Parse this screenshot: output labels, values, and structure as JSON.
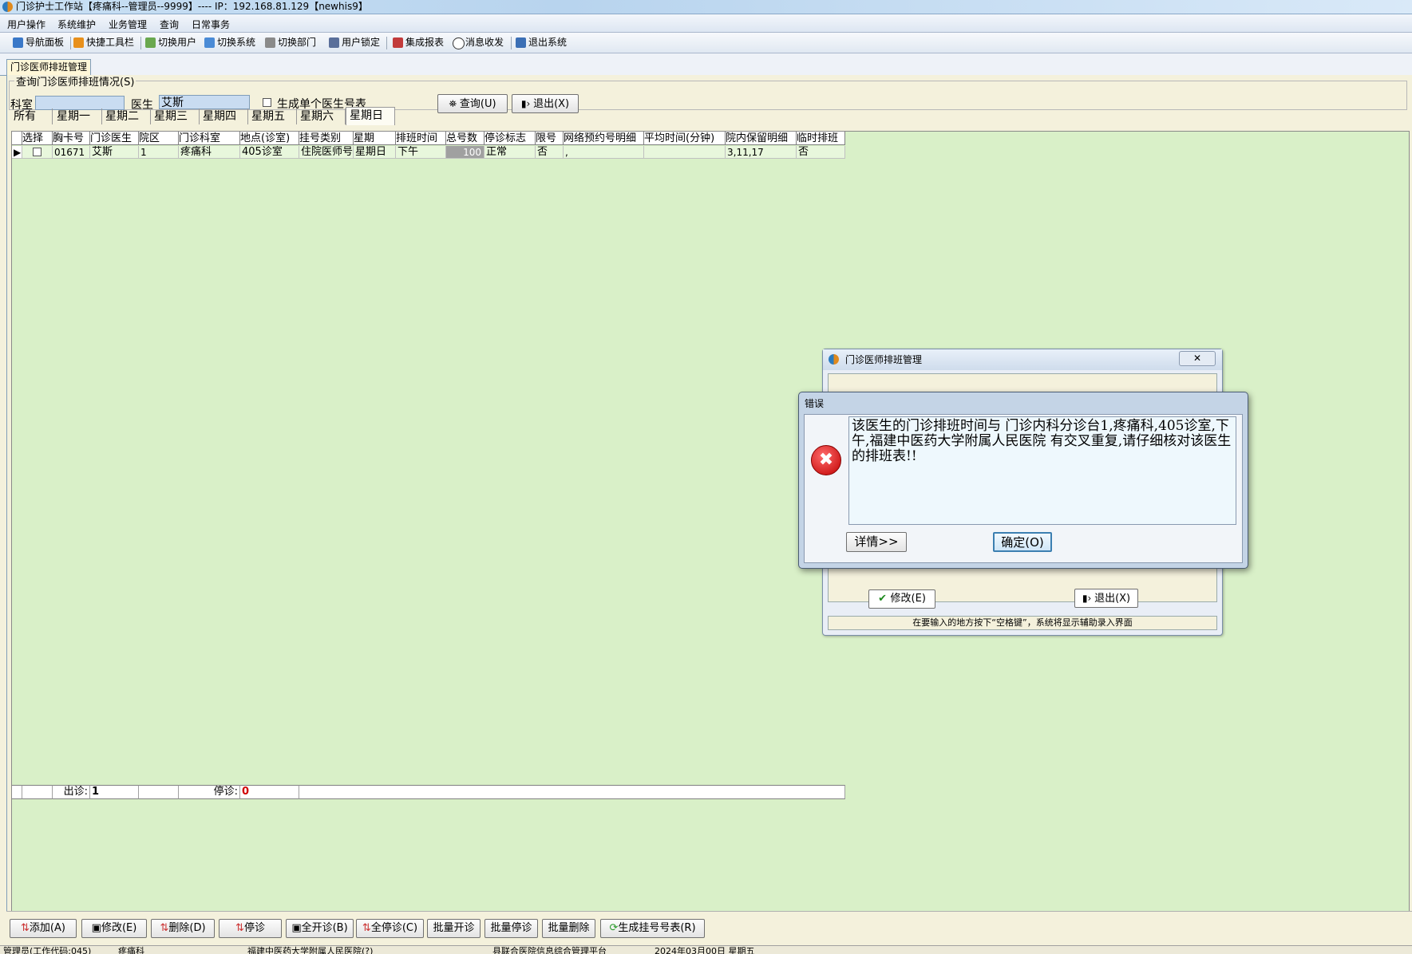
{
  "window": {
    "title": "门诊护士工作站【疼痛科--管理员--9999】---- IP：192.168.81.129【newhis9】"
  },
  "menu": [
    "用户操作",
    "系统维护",
    "业务管理",
    "查询",
    "日常事务"
  ],
  "toolbar": [
    "导航面板",
    "快捷工具栏",
    "切换用户",
    "切换系统",
    "切换部门",
    "用户锁定",
    "集成报表",
    "消息收发",
    "退出系统"
  ],
  "tab": {
    "label": "门诊医师排班管理"
  },
  "query": {
    "legend": "查询门诊医师排班情况(S)",
    "dept_label": "科室",
    "dept_value": "",
    "doctor_label": "医生",
    "doctor_value": "艾斯",
    "single_label": "生成单个医生号表",
    "search_btn": "查询(U)",
    "exit_btn": "退出(X)"
  },
  "days": [
    "所有",
    "星期一",
    "星期二",
    "星期三",
    "星期四",
    "星期五",
    "星期六",
    "星期日"
  ],
  "grid": {
    "headers": [
      "选择",
      "胸卡号",
      "门诊医生",
      "院区",
      "门诊科室",
      "地点(诊室)",
      "挂号类别",
      "星期",
      "排班时间",
      "总号数",
      "停诊标志",
      "限号",
      "网络预约号明细",
      "平均时间(分钟)",
      "院内保留明细",
      "临时排班"
    ],
    "rows": [
      [
        "",
        "01671",
        "艾斯",
        "1",
        "疼痛科",
        "405诊室",
        "住院医师号",
        "星期日",
        "下午",
        "100",
        "正常",
        "否",
        ",",
        "",
        "3,11,17",
        "否"
      ]
    ],
    "footer": {
      "out_label": "出诊:",
      "out_value": "1",
      "stop_label": "停诊:",
      "stop_value": "0"
    }
  },
  "actions": [
    "添加(A)",
    "修改(E)",
    "删除(D)",
    "停诊",
    "全开诊(B)",
    "全停诊(C)",
    "批量开诊",
    "批量停诊",
    "批量删除",
    "生成挂号号表(R)"
  ],
  "status": [
    "管理员(工作代码:045)",
    "疼痛科",
    "福建中医药大学附属人民医院(?)",
    "县联合医院信息综合管理平台",
    "2024年03月00日 星期五"
  ],
  "bg_dialog": {
    "title": "门诊医师排班管理",
    "edit_btn": "修改(E)",
    "exit_btn": "退出(X)",
    "hint": "在要输入的地方按下“空格键”，系统将显示辅助录入界面"
  },
  "error_dialog": {
    "title": "错误",
    "message": "该医生的门诊排班时间与 门诊内科分诊台1,疼痛科,405诊室,下午,福建中医药大学附属人民医院 有交叉重复,请仔细核对该医生的排班表!!",
    "details_btn": "详情>>",
    "ok_btn": "确定(O)"
  }
}
